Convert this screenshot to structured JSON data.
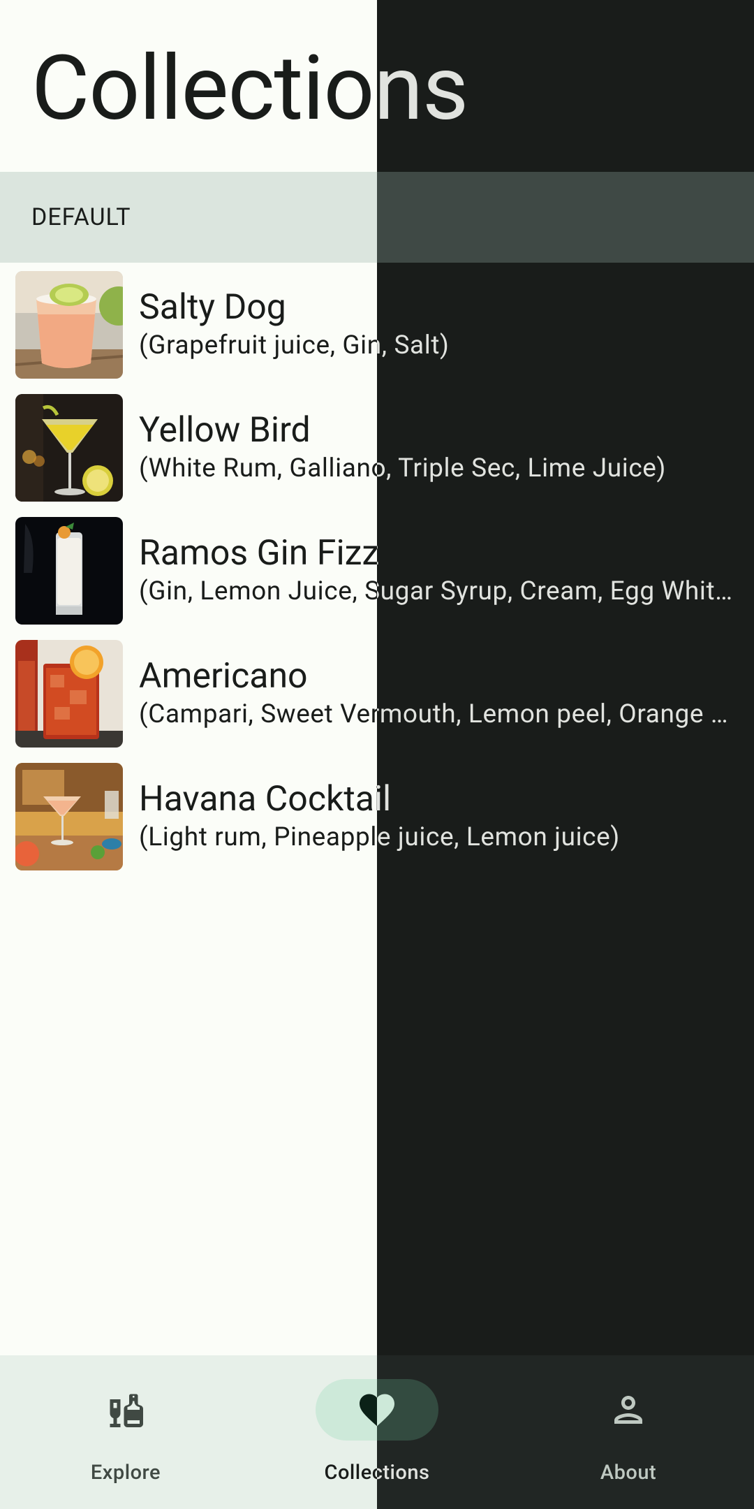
{
  "header": {
    "title": "Collections"
  },
  "section": {
    "label": "DEFAULT"
  },
  "items": [
    {
      "name": "Salty Dog",
      "ingredients": "(Grapefruit juice, Gin, Salt)",
      "image": "salty-dog-thumbnail"
    },
    {
      "name": "Yellow Bird",
      "ingredients": "(White Rum, Galliano, Triple Sec, Lime Juice)",
      "image": "yellow-bird-thumbnail"
    },
    {
      "name": "Ramos Gin Fizz",
      "ingredients": "(Gin, Lemon Juice, Sugar Syrup, Cream, Egg White, Orange Flower Water, Soda Water)",
      "image": "ramos-gin-fizz-thumbnail"
    },
    {
      "name": "Americano",
      "ingredients": "(Campari, Sweet Vermouth, Lemon peel, Orange peel)",
      "image": "americano-thumbnail"
    },
    {
      "name": "Havana Cocktail",
      "ingredients": "(Light rum, Pineapple juice, Lemon juice)",
      "image": "havana-cocktail-thumbnail"
    }
  ],
  "nav": {
    "explore": {
      "label": "Explore",
      "icon": "liquor-bottle-icon"
    },
    "collections": {
      "label": "Collections",
      "icon": "heart-icon",
      "selected": true
    },
    "about": {
      "label": "About",
      "icon": "person-icon"
    }
  },
  "colors": {
    "light_background": "#fbfdf8",
    "dark_background": "#191c1a",
    "light_section": "#dbe5de",
    "dark_section": "#3f4945",
    "light_nav": "#e7f0e9",
    "dark_nav": "#212624",
    "light_indicator": "#cde9d9",
    "dark_indicator": "#334b40"
  }
}
